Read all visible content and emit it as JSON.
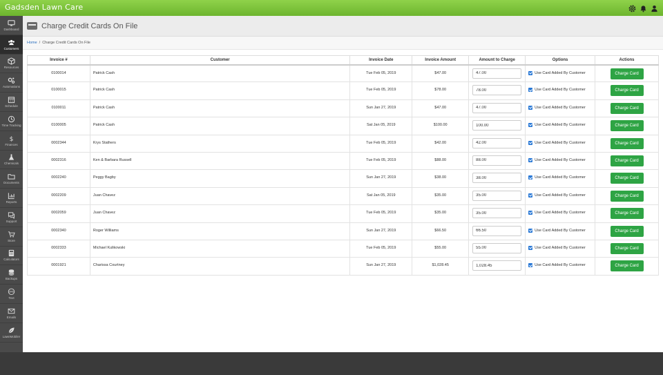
{
  "app": {
    "title": "Gadsden Lawn Care"
  },
  "topbar_icons": [
    "gear-icon",
    "bell-icon",
    "user-icon"
  ],
  "sidebar": {
    "items": [
      {
        "label": "Dashboard",
        "icon": "monitor-icon",
        "active": false
      },
      {
        "label": "Customers",
        "icon": "users-icon",
        "active": true
      },
      {
        "label": "Resources",
        "icon": "box-icon",
        "active": false
      },
      {
        "label": "Automations",
        "icon": "cogs-icon",
        "active": false
      },
      {
        "label": "Schedule",
        "icon": "calendar-icon",
        "active": false
      },
      {
        "label": "Time Tracking",
        "icon": "clock-icon",
        "active": false
      },
      {
        "label": "Finances",
        "icon": "dollar-icon",
        "active": false
      },
      {
        "label": "Chemicals",
        "icon": "flask-icon",
        "active": false
      },
      {
        "label": "Documents",
        "icon": "folder-icon",
        "active": false
      },
      {
        "label": "Reports",
        "icon": "chart-icon",
        "active": false
      },
      {
        "label": "Support",
        "icon": "chat-icon",
        "active": false
      },
      {
        "label": "Store",
        "icon": "cart-icon",
        "active": false
      },
      {
        "label": "Calculators",
        "icon": "calculator-icon",
        "active": false
      },
      {
        "label": "Backups",
        "icon": "database-icon",
        "active": false
      },
      {
        "label": "Text",
        "icon": "sms-icon",
        "active": false
      },
      {
        "label": "Emails",
        "icon": "envelope-icon",
        "active": false
      },
      {
        "label": "LawnMobiler",
        "icon": "leaf-icon",
        "active": false
      }
    ]
  },
  "page": {
    "title": "Charge Credit Cards On File"
  },
  "breadcrumb": {
    "home": "Home",
    "separator": "/",
    "current": "Charge Credit Cards On File"
  },
  "table": {
    "headers": [
      "Invoice #",
      "Customer",
      "Invoice Date",
      "Invoice Amount",
      "Amount to Charge",
      "Options",
      "Actions"
    ],
    "option_label": "Use Card Added By Customer",
    "button_label": "Charge Card",
    "rows": [
      {
        "invoice": "0100014",
        "customer": "Patrick Cash",
        "date": "Tue Feb 05, 2019",
        "amount": "$47.00",
        "charge": "47.00"
      },
      {
        "invoice": "0100015",
        "customer": "Patrick Cash",
        "date": "Tue Feb 05, 2019",
        "amount": "$78.00",
        "charge": "78.00"
      },
      {
        "invoice": "0100011",
        "customer": "Patrick Cash",
        "date": "Sun Jan 27, 2019",
        "amount": "$47.00",
        "charge": "47.00"
      },
      {
        "invoice": "0100005",
        "customer": "Patrick Cash",
        "date": "Sat Jan 05, 2019",
        "amount": "$100.00",
        "charge": "100.00"
      },
      {
        "invoice": "0002344",
        "customer": "Krys Stathers",
        "date": "Tue Feb 05, 2019",
        "amount": "$42.00",
        "charge": "42.00"
      },
      {
        "invoice": "0002316",
        "customer": "Ken & Barbara Russell",
        "date": "Tue Feb 05, 2019",
        "amount": "$88.00",
        "charge": "88.00"
      },
      {
        "invoice": "0002240",
        "customer": "Peggy Bagby",
        "date": "Sun Jan 27, 2019",
        "amount": "$38.00",
        "charge": "38.00"
      },
      {
        "invoice": "0002209",
        "customer": "Juan Chavez",
        "date": "Sat Jan 05, 2019",
        "amount": "$35.00",
        "charge": "35.00"
      },
      {
        "invoice": "0002059",
        "customer": "Juan Chavez",
        "date": "Tue Feb 05, 2019",
        "amount": "$35.00",
        "charge": "35.00"
      },
      {
        "invoice": "0002340",
        "customer": "Roger Williams",
        "date": "Sun Jan 27, 2019",
        "amount": "$66.50",
        "charge": "66.50"
      },
      {
        "invoice": "0002333",
        "customer": "Michael Kulikowski",
        "date": "Tue Feb 05, 2019",
        "amount": "$55.00",
        "charge": "55.00"
      },
      {
        "invoice": "0001921",
        "customer": "Charissa Courtney",
        "date": "Sun Jan 27, 2019",
        "amount": "$1,028.45",
        "charge": "1,028.45"
      }
    ]
  },
  "colors": {
    "topbar": "#7cc43c",
    "accent_button": "#2ea444",
    "link": "#2a6ebd",
    "checkbox": "#2a79d6",
    "sidebar": "#4a4a4a"
  }
}
